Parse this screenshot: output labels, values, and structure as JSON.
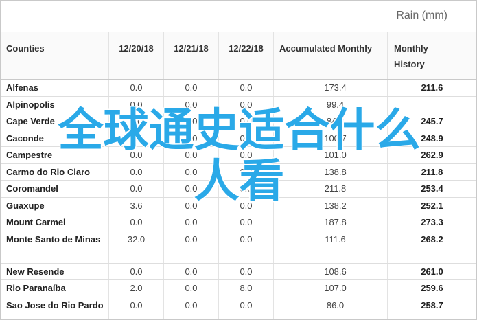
{
  "header": {
    "caption": "Rain (mm)"
  },
  "table": {
    "columns": [
      "Counties",
      "12/20/18",
      "12/21/18",
      "12/22/18",
      "Accumulated Monthly",
      "Monthly History"
    ],
    "rows": [
      [
        "Alfenas",
        "0.0",
        "0.0",
        "0.0",
        "173.4",
        "211.6"
      ],
      [
        "Alpinopolis",
        "0.0",
        "0.0",
        "0.0",
        "99.4",
        ""
      ],
      [
        "Cape Verde",
        "1.0",
        "0.0",
        "0.0",
        "84.2",
        "245.7"
      ],
      [
        "Caconde",
        "0.0",
        "0.0",
        "0.0",
        "100.7",
        "248.9"
      ],
      [
        "Campestre",
        "0.0",
        "0.0",
        "0.0",
        "101.0",
        "262.9"
      ],
      [
        "Carmo do Rio Claro",
        "0.0",
        "0.0",
        "0.0",
        "138.8",
        "211.8"
      ],
      [
        "Coromandel",
        "0.0",
        "0.0",
        "0.0",
        "211.8",
        "253.4"
      ],
      [
        "Guaxupe",
        "3.6",
        "0.0",
        "0.0",
        "138.2",
        "252.1"
      ],
      [
        "Mount Carmel",
        "0.0",
        "0.0",
        "0.0",
        "187.8",
        "273.3"
      ],
      [
        "Monte Santo de Minas",
        "32.0",
        "0.0",
        "0.0",
        "111.6",
        "268.2"
      ],
      [
        "New Resende",
        "0.0",
        "0.0",
        "0.0",
        "108.6",
        "261.0"
      ],
      [
        "Rio Paranaíba",
        "2.0",
        "0.0",
        "8.0",
        "107.0",
        "259.6"
      ],
      [
        "Sao Jose do Rio Pardo",
        "0.0",
        "0.0",
        "0.0",
        "86.0",
        "258.7"
      ]
    ]
  },
  "overlay": {
    "line1": "全球通史适合什么",
    "line2": "人看"
  }
}
